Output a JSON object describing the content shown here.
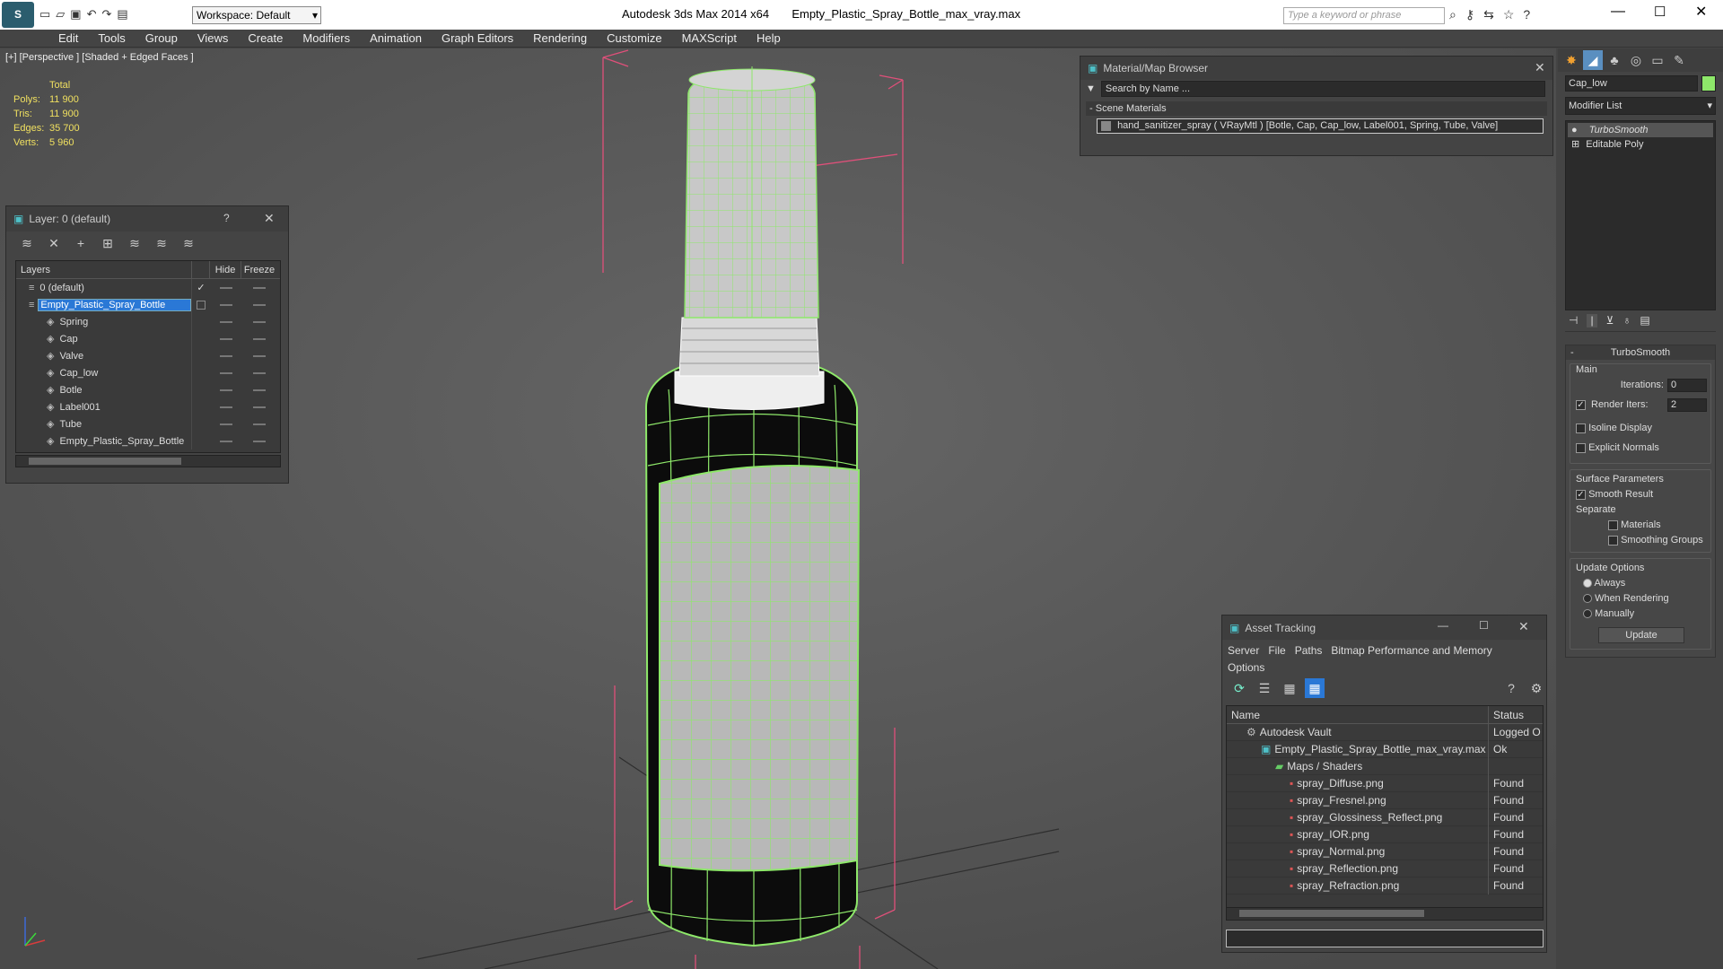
{
  "app": {
    "title_app": "Autodesk 3ds Max  2014 x64",
    "title_file": "Empty_Plastic_Spray_Bottle_max_vray.max",
    "workspace": "Workspace: Default",
    "search_placeholder": "Type a keyword or phrase"
  },
  "menu": [
    "Edit",
    "Tools",
    "Group",
    "Views",
    "Create",
    "Modifiers",
    "Animation",
    "Graph Editors",
    "Rendering",
    "Customize",
    "MAXScript",
    "Help"
  ],
  "viewport": {
    "label": "[+] [Perspective ] [Shaded + Edged Faces ]",
    "stats": {
      "total_label": "Total",
      "rows": [
        {
          "label": "Polys:",
          "value": "11 900"
        },
        {
          "label": "Tris:",
          "value": "11 900"
        },
        {
          "label": "Edges:",
          "value": "35 700"
        },
        {
          "label": "Verts:",
          "value": "5 960"
        }
      ]
    }
  },
  "layer_window": {
    "title": "Layer: 0 (default)",
    "help": "?",
    "col_layers": "Layers",
    "col_hide": "Hide",
    "col_freeze": "Freeze",
    "rows": [
      {
        "name": "0 (default)",
        "indent": 1,
        "type": "layer"
      },
      {
        "name": "Empty_Plastic_Spray_Bottle",
        "indent": 1,
        "type": "layer",
        "selected": true
      },
      {
        "name": "Spring",
        "indent": 2,
        "type": "object"
      },
      {
        "name": "Cap",
        "indent": 2,
        "type": "object"
      },
      {
        "name": "Valve",
        "indent": 2,
        "type": "object"
      },
      {
        "name": "Cap_low",
        "indent": 2,
        "type": "object"
      },
      {
        "name": "Botle",
        "indent": 2,
        "type": "object"
      },
      {
        "name": "Label001",
        "indent": 2,
        "type": "object"
      },
      {
        "name": "Tube",
        "indent": 2,
        "type": "object"
      },
      {
        "name": "Empty_Plastic_Spray_Bottle",
        "indent": 2,
        "type": "object"
      }
    ]
  },
  "material_browser": {
    "title": "Material/Map Browser",
    "search_placeholder": "Search by Name ...",
    "section": "Scene Materials",
    "entry": "hand_sanitizer_spray  ( VRayMtl )  [Botle, Cap, Cap_low, Label001, Spring, Tube, Valve]"
  },
  "asset_tracking": {
    "title": "Asset Tracking",
    "menu": [
      "Server",
      "File",
      "Paths",
      "Bitmap Performance and Memory"
    ],
    "menu2": "Options",
    "col_name": "Name",
    "col_status": "Status",
    "rows": [
      {
        "name": "Autodesk Vault",
        "status": "Logged O",
        "indent": 1
      },
      {
        "name": "Empty_Plastic_Spray_Bottle_max_vray.max",
        "status": "Ok",
        "indent": 2
      },
      {
        "name": "Maps / Shaders",
        "status": "",
        "indent": 3
      },
      {
        "name": "spray_Diffuse.png",
        "status": "Found",
        "indent": 4
      },
      {
        "name": "spray_Fresnel.png",
        "status": "Found",
        "indent": 4
      },
      {
        "name": "spray_Glossiness_Reflect.png",
        "status": "Found",
        "indent": 4
      },
      {
        "name": "spray_IOR.png",
        "status": "Found",
        "indent": 4
      },
      {
        "name": "spray_Normal.png",
        "status": "Found",
        "indent": 4
      },
      {
        "name": "spray_Reflection.png",
        "status": "Found",
        "indent": 4
      },
      {
        "name": "spray_Refraction.png",
        "status": "Found",
        "indent": 4
      }
    ]
  },
  "command_panel": {
    "object_name": "Cap_low",
    "modifier_list": "Modifier List",
    "stack": [
      "TurboSmooth",
      "Editable Poly"
    ],
    "rollout_title": "TurboSmooth",
    "main_label": "Main",
    "iterations_label": "Iterations:",
    "iterations_value": "0",
    "render_iters_label": "Render Iters:",
    "render_iters_value": "2",
    "isoline": "Isoline Display",
    "explicit": "Explicit Normals",
    "surface_label": "Surface Parameters",
    "smooth_result": "Smooth Result",
    "separate_label": "Separate",
    "materials": "Materials",
    "smoothing_groups": "Smoothing Groups",
    "update_label": "Update Options",
    "always": "Always",
    "when_rendering": "When Rendering",
    "manually": "Manually",
    "update_button": "Update"
  },
  "colors": {
    "wire_green": "#8ee86a",
    "selection_blue": "#2a78d6",
    "bbox_pink": "#e0507a"
  }
}
